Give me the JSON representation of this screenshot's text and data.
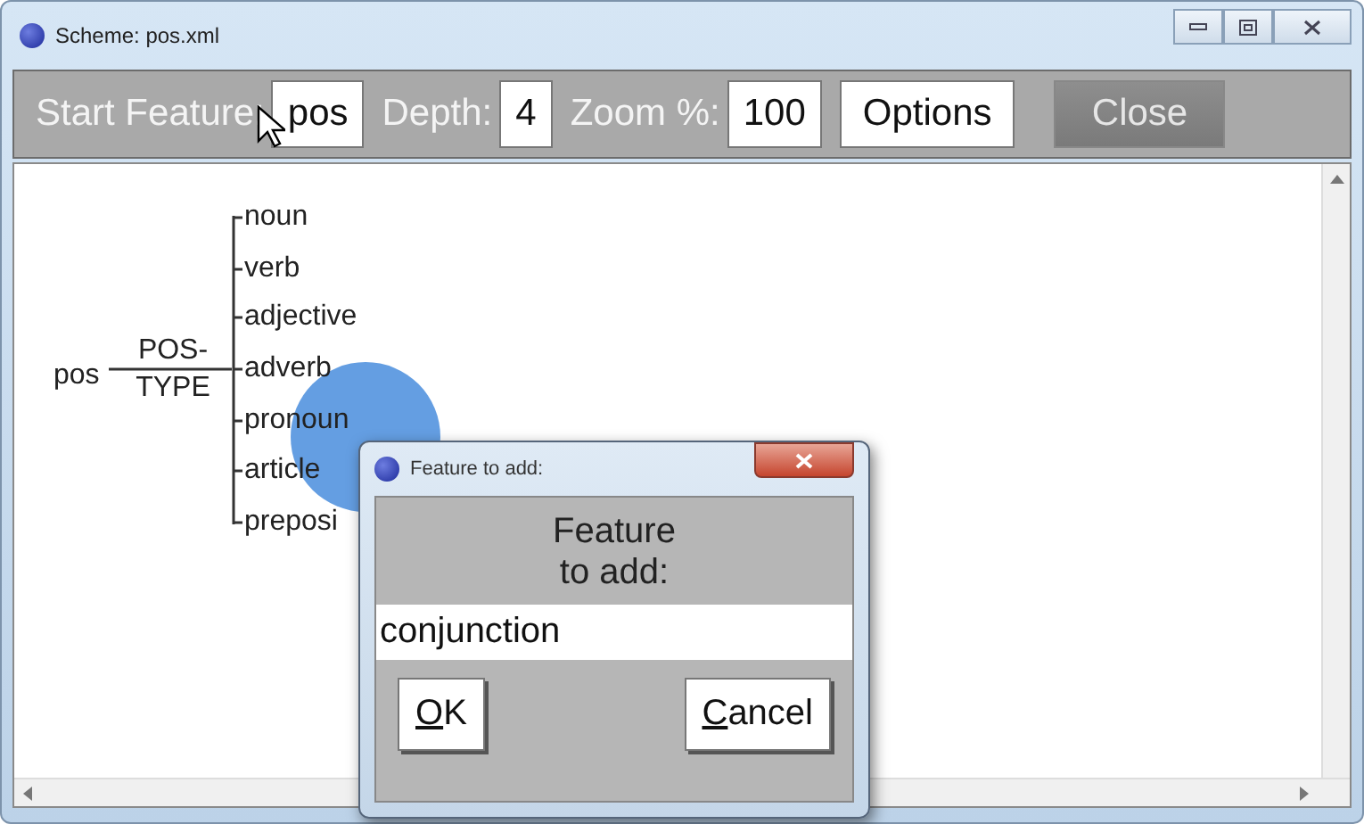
{
  "window": {
    "title": "Scheme: pos.xml"
  },
  "toolbar": {
    "fields": [
      {
        "label": "Start Feature:",
        "value": "pos"
      },
      {
        "label": "Depth:",
        "value": "4"
      },
      {
        "label": "Zoom %:",
        "value": "100"
      }
    ],
    "buttons": [
      {
        "label": "Options",
        "disabled": false
      },
      {
        "label": "Close",
        "disabled": true
      }
    ]
  },
  "tree": {
    "root": "pos",
    "edge_label": [
      "POS-",
      "TYPE"
    ],
    "children": [
      "noun",
      "verb",
      "adjective",
      "adverb",
      "pronoun",
      "article",
      "preposi"
    ]
  },
  "dialog": {
    "title": "Feature to add:",
    "prompt": "Feature to add:",
    "value": "conjunction",
    "buttons": [
      "OK",
      "Cancel"
    ]
  }
}
